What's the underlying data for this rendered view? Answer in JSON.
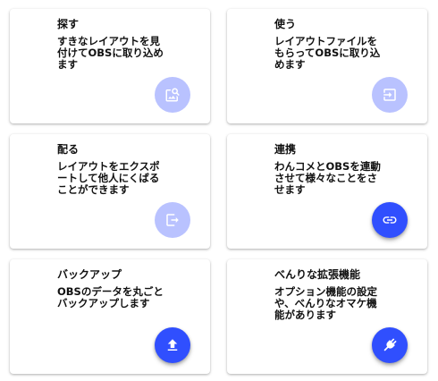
{
  "colors": {
    "fab_active": "#304ffe",
    "fab_inactive": "#b9c2ff",
    "icon": "#ffffff"
  },
  "cards": [
    {
      "title": "探す",
      "description": "すきなレイアウトを見付けてOBSに取り込めます",
      "icon": "image-search-icon",
      "state": "inactive"
    },
    {
      "title": "使う",
      "description": "レイアウトファイルをもらってOBSに取り込めます",
      "icon": "import-icon",
      "state": "inactive"
    },
    {
      "title": "配る",
      "description": "レイアウトをエクスポートして他人にくばることができます",
      "icon": "export-icon",
      "state": "inactive"
    },
    {
      "title": "連携",
      "description": "わんコメとOBSを連動させて様々なことをさせます",
      "icon": "link-icon",
      "state": "active"
    },
    {
      "title": "バックアップ",
      "description": "OBSのデータを丸ごとバックアップします",
      "icon": "upload-icon",
      "state": "active"
    },
    {
      "title": "べんりな拡張機能",
      "description": "オプション機能の設定や、べんりなオマケ機能があります",
      "icon": "plugin-icon",
      "state": "active"
    }
  ]
}
